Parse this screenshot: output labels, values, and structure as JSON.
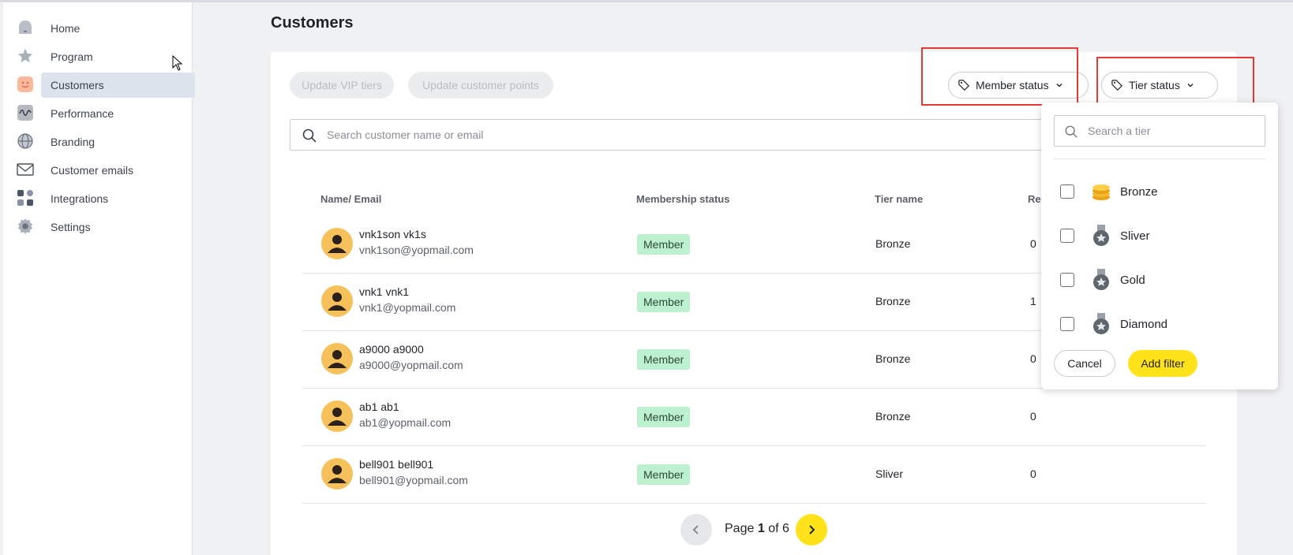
{
  "sidebar": {
    "items": [
      {
        "label": "Home",
        "icon": "home-icon"
      },
      {
        "label": "Program",
        "icon": "star-icon"
      },
      {
        "label": "Customers",
        "icon": "smiley-icon",
        "active": true
      },
      {
        "label": "Performance",
        "icon": "wave-icon"
      },
      {
        "label": "Branding",
        "icon": "globe-icon"
      },
      {
        "label": "Customer emails",
        "icon": "envelope-icon"
      },
      {
        "label": "Integrations",
        "icon": "grid-icon"
      },
      {
        "label": "Settings",
        "icon": "gear-icon"
      }
    ]
  },
  "page": {
    "title": "Customers"
  },
  "toolbar": {
    "update_vip_tiers": "Update VIP tiers",
    "update_customer_points": "Update customer points",
    "member_status": "Member status",
    "tier_status": "Tier status"
  },
  "search": {
    "placeholder": "Search customer name or email"
  },
  "table": {
    "headers": [
      "Name/ Email",
      "Membership status",
      "Tier name",
      "Re"
    ],
    "rows": [
      {
        "name": "vnk1son vk1s",
        "email": "vnk1son@yopmail.com",
        "status": "Member",
        "tier": "Bronze",
        "rewards": "0"
      },
      {
        "name": "vnk1 vnk1",
        "email": "vnk1@yopmail.com",
        "status": "Member",
        "tier": "Bronze",
        "rewards": "1"
      },
      {
        "name": "a9000 a9000",
        "email": "a9000@yopmail.com",
        "status": "Member",
        "tier": "Bronze",
        "rewards": "0"
      },
      {
        "name": "ab1 ab1",
        "email": "ab1@yopmail.com",
        "status": "Member",
        "tier": "Bronze",
        "rewards": "0"
      },
      {
        "name": "bell901 bell901",
        "email": "bell901@yopmail.com",
        "status": "Member",
        "tier": "Sliver",
        "rewards": "0"
      }
    ]
  },
  "pagination": {
    "prefix": "Page",
    "current": "1",
    "of": "of",
    "total": "6"
  },
  "tier_dropdown": {
    "search_placeholder": "Search a tier",
    "options": [
      {
        "label": "Bronze",
        "icon": "coins-icon"
      },
      {
        "label": "Sliver",
        "icon": "medal-icon"
      },
      {
        "label": "Gold",
        "icon": "medal-icon"
      },
      {
        "label": "Diamond",
        "icon": "medal-icon"
      }
    ],
    "cancel": "Cancel",
    "add_filter": "Add filter"
  },
  "colors": {
    "accent": "#ffe21a",
    "badge": "#bdf0cf",
    "highlight": "#e53935",
    "avatar": "#f6c15a"
  }
}
